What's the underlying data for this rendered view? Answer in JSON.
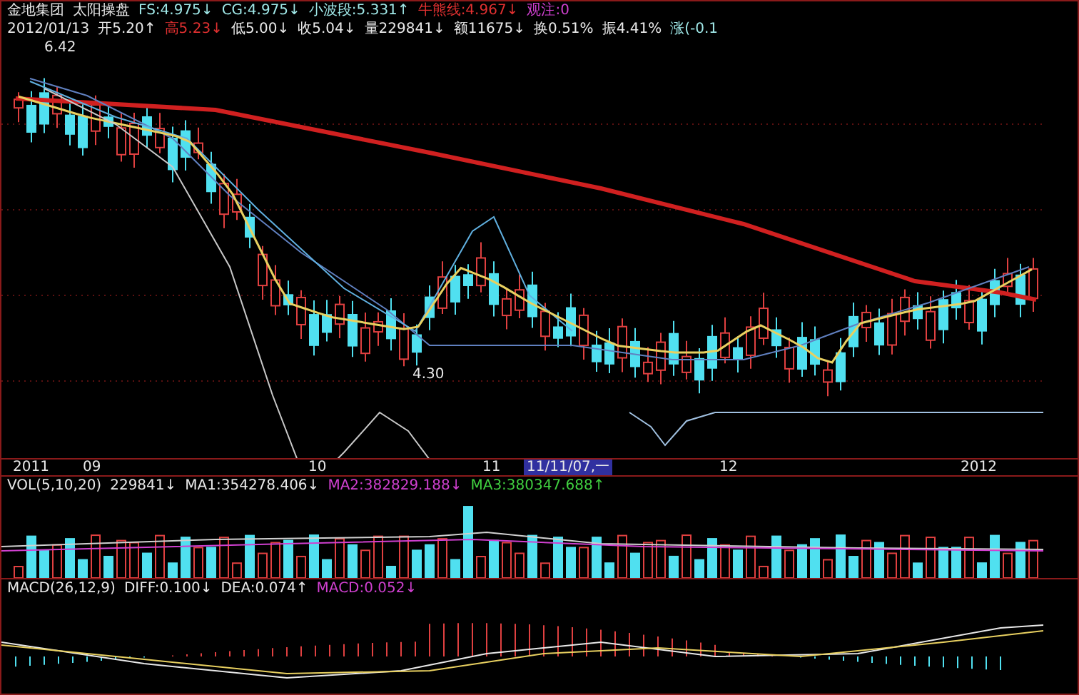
{
  "header": {
    "items": [
      {
        "text": "金地集团",
        "color": "#e8e8e8"
      },
      {
        "text": "太阳操盘",
        "color": "#e8e8e8"
      },
      {
        "text": "FS:4.975↓",
        "color": "#9fe7e7"
      },
      {
        "text": "CG:4.975↓",
        "color": "#9fe7e7"
      },
      {
        "text": "小波段:5.331↑",
        "color": "#9fe7e7"
      },
      {
        "text": "牛熊线:4.967↓",
        "color": "#e03030"
      },
      {
        "text": "观注:0",
        "color": "#d040d0"
      }
    ]
  },
  "quote": {
    "items": [
      {
        "text": "2012/01/13",
        "color": "#e8e8e8"
      },
      {
        "text": "开5.20↑",
        "color": "#e8e8e8"
      },
      {
        "text": "高5.23↓",
        "color": "#e03030"
      },
      {
        "text": "低5.00↓",
        "color": "#e8e8e8"
      },
      {
        "text": "收5.04↓",
        "color": "#e8e8e8"
      },
      {
        "text": "量229841↓",
        "color": "#e8e8e8"
      },
      {
        "text": "额11675↓",
        "color": "#e8e8e8"
      },
      {
        "text": "换0.51%",
        "color": "#e8e8e8"
      },
      {
        "text": "振4.41%",
        "color": "#e8e8e8"
      },
      {
        "text": "涨(-0.1",
        "color": "#9fe7e7"
      }
    ]
  },
  "price_labels": [
    {
      "text": "6.42"
    },
    {
      "text": "4.30"
    }
  ],
  "x_axis": {
    "labels": [
      {
        "text": "2011"
      },
      {
        "text": "09"
      },
      {
        "text": "10"
      },
      {
        "text": "11"
      },
      {
        "text": "12"
      },
      {
        "text": "2012"
      }
    ],
    "cursor": "11/11/07,一"
  },
  "volume": {
    "items": [
      {
        "text": "VOL(5,10,20)",
        "color": "#e8e8e8"
      },
      {
        "text": "229841↓",
        "color": "#e8e8e8"
      },
      {
        "text": "MA1:354278.406↓",
        "color": "#e8e8e8"
      },
      {
        "text": "MA2:382829.188↓",
        "color": "#d040d0"
      },
      {
        "text": "MA3:380347.688↑",
        "color": "#40d040"
      }
    ]
  },
  "macd": {
    "items": [
      {
        "text": "MACD(26,12,9)",
        "color": "#e8e8e8"
      },
      {
        "text": "DIFF:0.100↓",
        "color": "#e8e8e8"
      },
      {
        "text": "DEA:0.074↑",
        "color": "#e8e8e8"
      },
      {
        "text": "MACD:0.052↓",
        "color": "#d040d0"
      }
    ]
  }
}
